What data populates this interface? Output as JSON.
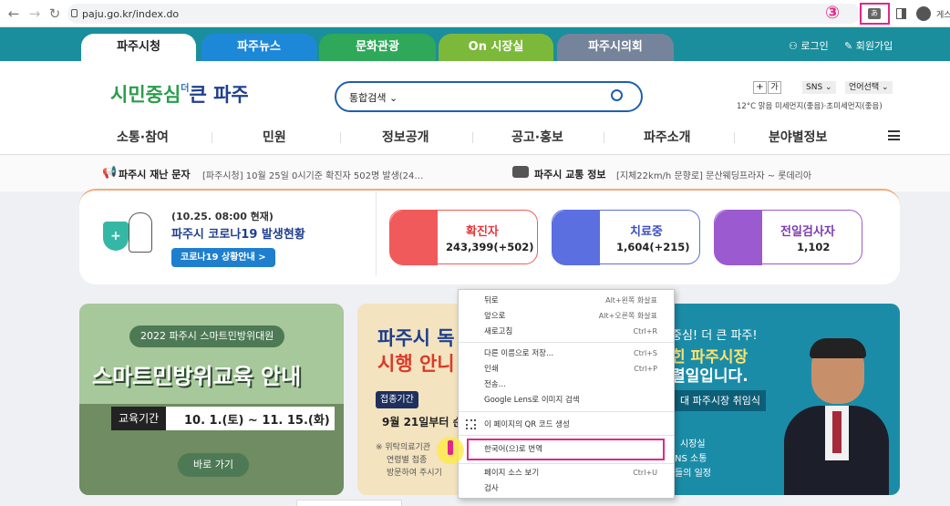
{
  "browser": {
    "url": "paju.go.kr/index.do",
    "annotation": "③",
    "profile_label": "게스"
  },
  "site": {
    "tabs": [
      "파주시청",
      "파주뉴스",
      "문화관광",
      "On 시장실",
      "파주시의회"
    ],
    "login": "로그인",
    "signup": "회원가입",
    "logo": {
      "part1": "시민중심",
      "part2": "더",
      "part3": "큰 파주"
    },
    "search": {
      "category": "통합검색"
    },
    "utility": {
      "zoom_in": "+",
      "zoom_out": "가",
      "sns": "SNS",
      "language": "언어선택",
      "weather": "12°C 맑음 미세먼지(좋음)·초미세먼지(좋음)"
    },
    "gnb": [
      "소통·참여",
      "민원",
      "정보공개",
      "공고·홍보",
      "파주소개",
      "분야별정보"
    ],
    "notice1": {
      "label": "파주시 재난 문자",
      "text": "[파주시청] 10월 25일 0시기준 확진자 502명 발생(24…"
    },
    "notice2": {
      "label": "파주시 교통 정보",
      "text": "[지체22km/h 문향로] 문산웨딩프라자 ~ 롯데리아"
    },
    "covid": {
      "date": "(10.25. 08:00 현재)",
      "title": "파주시 코로나19 발생현황",
      "button": "코로나19 상황안내 >",
      "stats": [
        {
          "label": "확진자",
          "value": "243,399(+502)"
        },
        {
          "label": "치료중",
          "value": "1,604(+215)"
        },
        {
          "label": "전일검사자",
          "value": "1,102"
        }
      ]
    },
    "banner1": {
      "tag": "2022 파주시 스마트민방위대원",
      "title": "스마트민방위교육 안내",
      "period_label": "교육기간",
      "period": "10. 1.(토) ~ 11. 15.(화)",
      "button": "바로 가기"
    },
    "banner2": {
      "title1": "파주시 독",
      "title2": "시행 안니",
      "tag": "접종기간",
      "date": "9월 21일부터 순",
      "note": "※ 위탁의료기관",
      "note2": "연령별 접종",
      "note3": "방문하여 주시기"
    },
    "banner3": {
      "line1": "중심! 더 큰 파주!",
      "line2": "힌 파주시장",
      "line3": "렬일입니다.",
      "tag": "대 파주시장 취임식",
      "small1": "시장실",
      "small2": "NS 소통",
      "small3": "들의 일정"
    }
  },
  "context_menu": {
    "items": [
      {
        "label": "뒤로",
        "shortcut": "Alt+왼쪽 화살표"
      },
      {
        "label": "앞으로",
        "shortcut": "Alt+오른쪽 화살표"
      },
      {
        "label": "새로고침",
        "shortcut": "Ctrl+R"
      },
      {
        "label": "다른 이름으로 저장...",
        "shortcut": "Ctrl+S"
      },
      {
        "label": "인쇄",
        "shortcut": "Ctrl+P"
      },
      {
        "label": "전송...",
        "shortcut": ""
      },
      {
        "label": "Google Lens로 이미지 검색",
        "shortcut": ""
      },
      {
        "label": "이 페이지의 QR 코드 생성",
        "shortcut": ""
      },
      {
        "label": "한국어(으)로 번역",
        "shortcut": ""
      },
      {
        "label": "페이지 소스 보기",
        "shortcut": "Ctrl+U"
      },
      {
        "label": "검사",
        "shortcut": ""
      }
    ]
  },
  "colors": {
    "header": "#1a8e9c",
    "highlight": "#e2278c",
    "confirmed": "#f15a5a",
    "treating": "#5b6fe0",
    "tested": "#9b5ad0"
  }
}
